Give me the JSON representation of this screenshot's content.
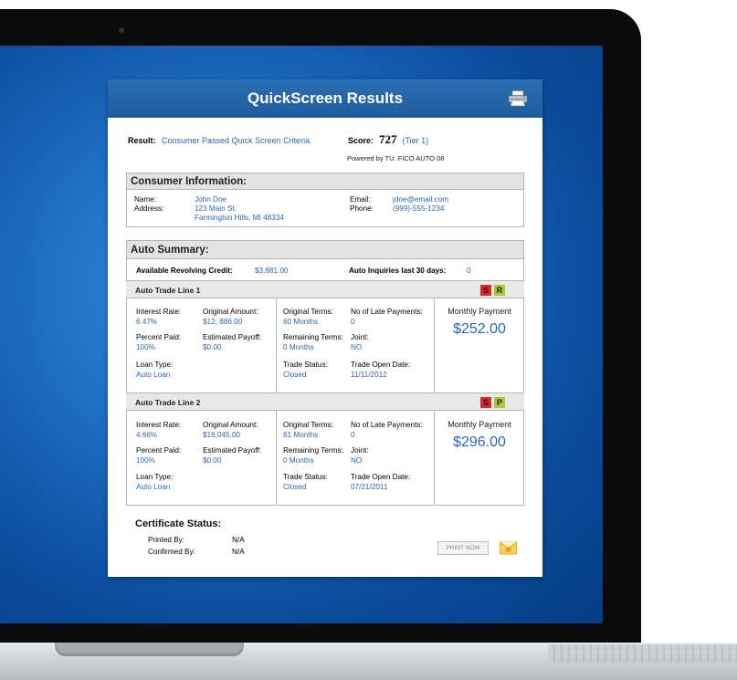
{
  "header": {
    "title": "QuickScreen Results",
    "print_icon": "printer-icon"
  },
  "result": {
    "label": "Result:",
    "value": "Consumer Passed Quick Screen Criteria",
    "score_label": "Score:",
    "score_value": "727",
    "tier": "(Tier 1)",
    "powered_by": "Powered by TU: FICO AUTO 08"
  },
  "consumer": {
    "heading": "Consumer Information:",
    "name_label": "Name:",
    "name": "John Doe",
    "address_label": "Address:",
    "address_line1": "123 Main St.",
    "address_line2": "Farmington Hills, MI 48334",
    "email_label": "Email:",
    "email": "jdoe@email.com",
    "phone_label": "Phone:",
    "phone": "(999)-555-1234"
  },
  "auto_summary": {
    "heading": "Auto Summary:",
    "revolving_label": "Available Revolving Credit:",
    "revolving_value": "$3,881.00",
    "inquiries_label": "Auto Inquiries last 30 days:",
    "inquiries_value": "0"
  },
  "field_labels": {
    "interest_rate": "Interest Rate:",
    "original_amount": "Original Amount:",
    "percent_paid": "Percent Paid:",
    "estimated_payoff": "Estimated Payoff:",
    "loan_type": "Loan Type:",
    "original_terms": "Original Terms:",
    "late_payments": "No of Late Payments:",
    "remaining_terms": "Remaining Terms:",
    "joint": "Joint:",
    "trade_status": "Trade Status:",
    "trade_open_date": "Trade Open Date:",
    "monthly_payment": "Monthly Payment"
  },
  "trade_lines": [
    {
      "title": "Auto Trade Line 1",
      "badges": [
        "S",
        "R"
      ],
      "interest_rate": "6.47%",
      "original_amount": "$12, 886.00",
      "percent_paid": "100%",
      "estimated_payoff": "$0.00",
      "loan_type": "Auto Loan",
      "original_terms": "60 Months",
      "late_payments": "0",
      "remaining_terms": "0 Months",
      "joint": "NO",
      "trade_status": "Closed",
      "trade_open_date": "11/11/2012",
      "monthly_payment": "$252.00"
    },
    {
      "title": "Auto Trade Line 2",
      "badges": [
        "S",
        "P"
      ],
      "interest_rate": "4.66%",
      "original_amount": "$16,045.00",
      "percent_paid": "100%",
      "estimated_payoff": "$0.00",
      "loan_type": "Auto Loan",
      "original_terms": "61 Months",
      "late_payments": "0",
      "remaining_terms": "0 Months",
      "joint": "NO",
      "trade_status": "Closed",
      "trade_open_date": "07/21/2011",
      "monthly_payment": "$296.00"
    }
  ],
  "certificate": {
    "heading": "Certificate Status:",
    "printed_by_label": "Printed By:",
    "printed_by": "N/A",
    "confirmed_by_label": "Confirmed By:",
    "confirmed_by": "N/A",
    "print_button": "PRINT NOW",
    "email_icon": "envelope-icon"
  },
  "colors": {
    "accent": "#2a66b8",
    "header_bg": "#1e5c9e",
    "badge_red": "#d62b2b",
    "badge_green": "#a7c83a"
  }
}
